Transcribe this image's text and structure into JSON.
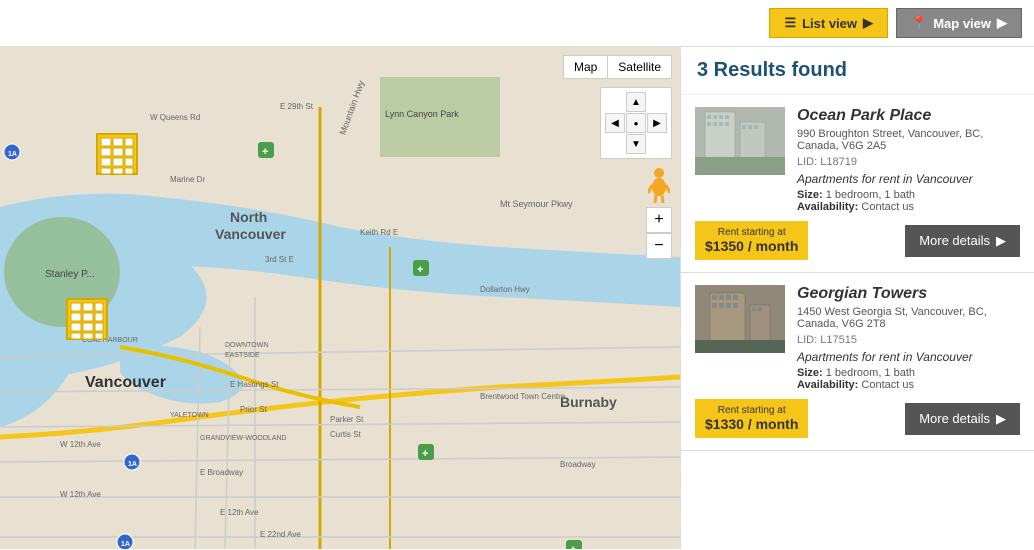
{
  "toolbar": {
    "list_view_label": "List view",
    "map_view_label": "Map view"
  },
  "map": {
    "map_btn": "Map",
    "satellite_btn": "Satellite",
    "zoom_in": "+",
    "zoom_out": "−",
    "nav_up": "▲",
    "nav_down": "▼",
    "nav_left": "◀",
    "nav_right": "▶",
    "nav_center": "●"
  },
  "results": {
    "count_text": "3 Results found",
    "listings": [
      {
        "title": "Ocean Park Place",
        "address": "990 Broughton Street, Vancouver, BC, Canada, V6G 2A5",
        "lid": "LID: L18719",
        "type": "Apartments for rent in Vancouver",
        "size": "1 bedroom, 1 bath",
        "availability": "Contact us",
        "rent_label": "Rent starting at",
        "rent_amount": "$1350 / month",
        "more_details": "More details"
      },
      {
        "title": "Georgian Towers",
        "address": "1450 West Georgia St, Vancouver, BC, Canada, V6G 2T8",
        "lid": "LID: L17515",
        "type": "Apartments for rent in Vancouver",
        "size": "1 bedroom, 1 bath",
        "availability": "Contact us",
        "rent_label": "Rent starting at",
        "rent_amount": "$1330 / month",
        "more_details": "More details"
      }
    ]
  },
  "labels": {
    "size_label": "Size:",
    "availability_label": "Availability:",
    "arrow_right": "▶"
  }
}
